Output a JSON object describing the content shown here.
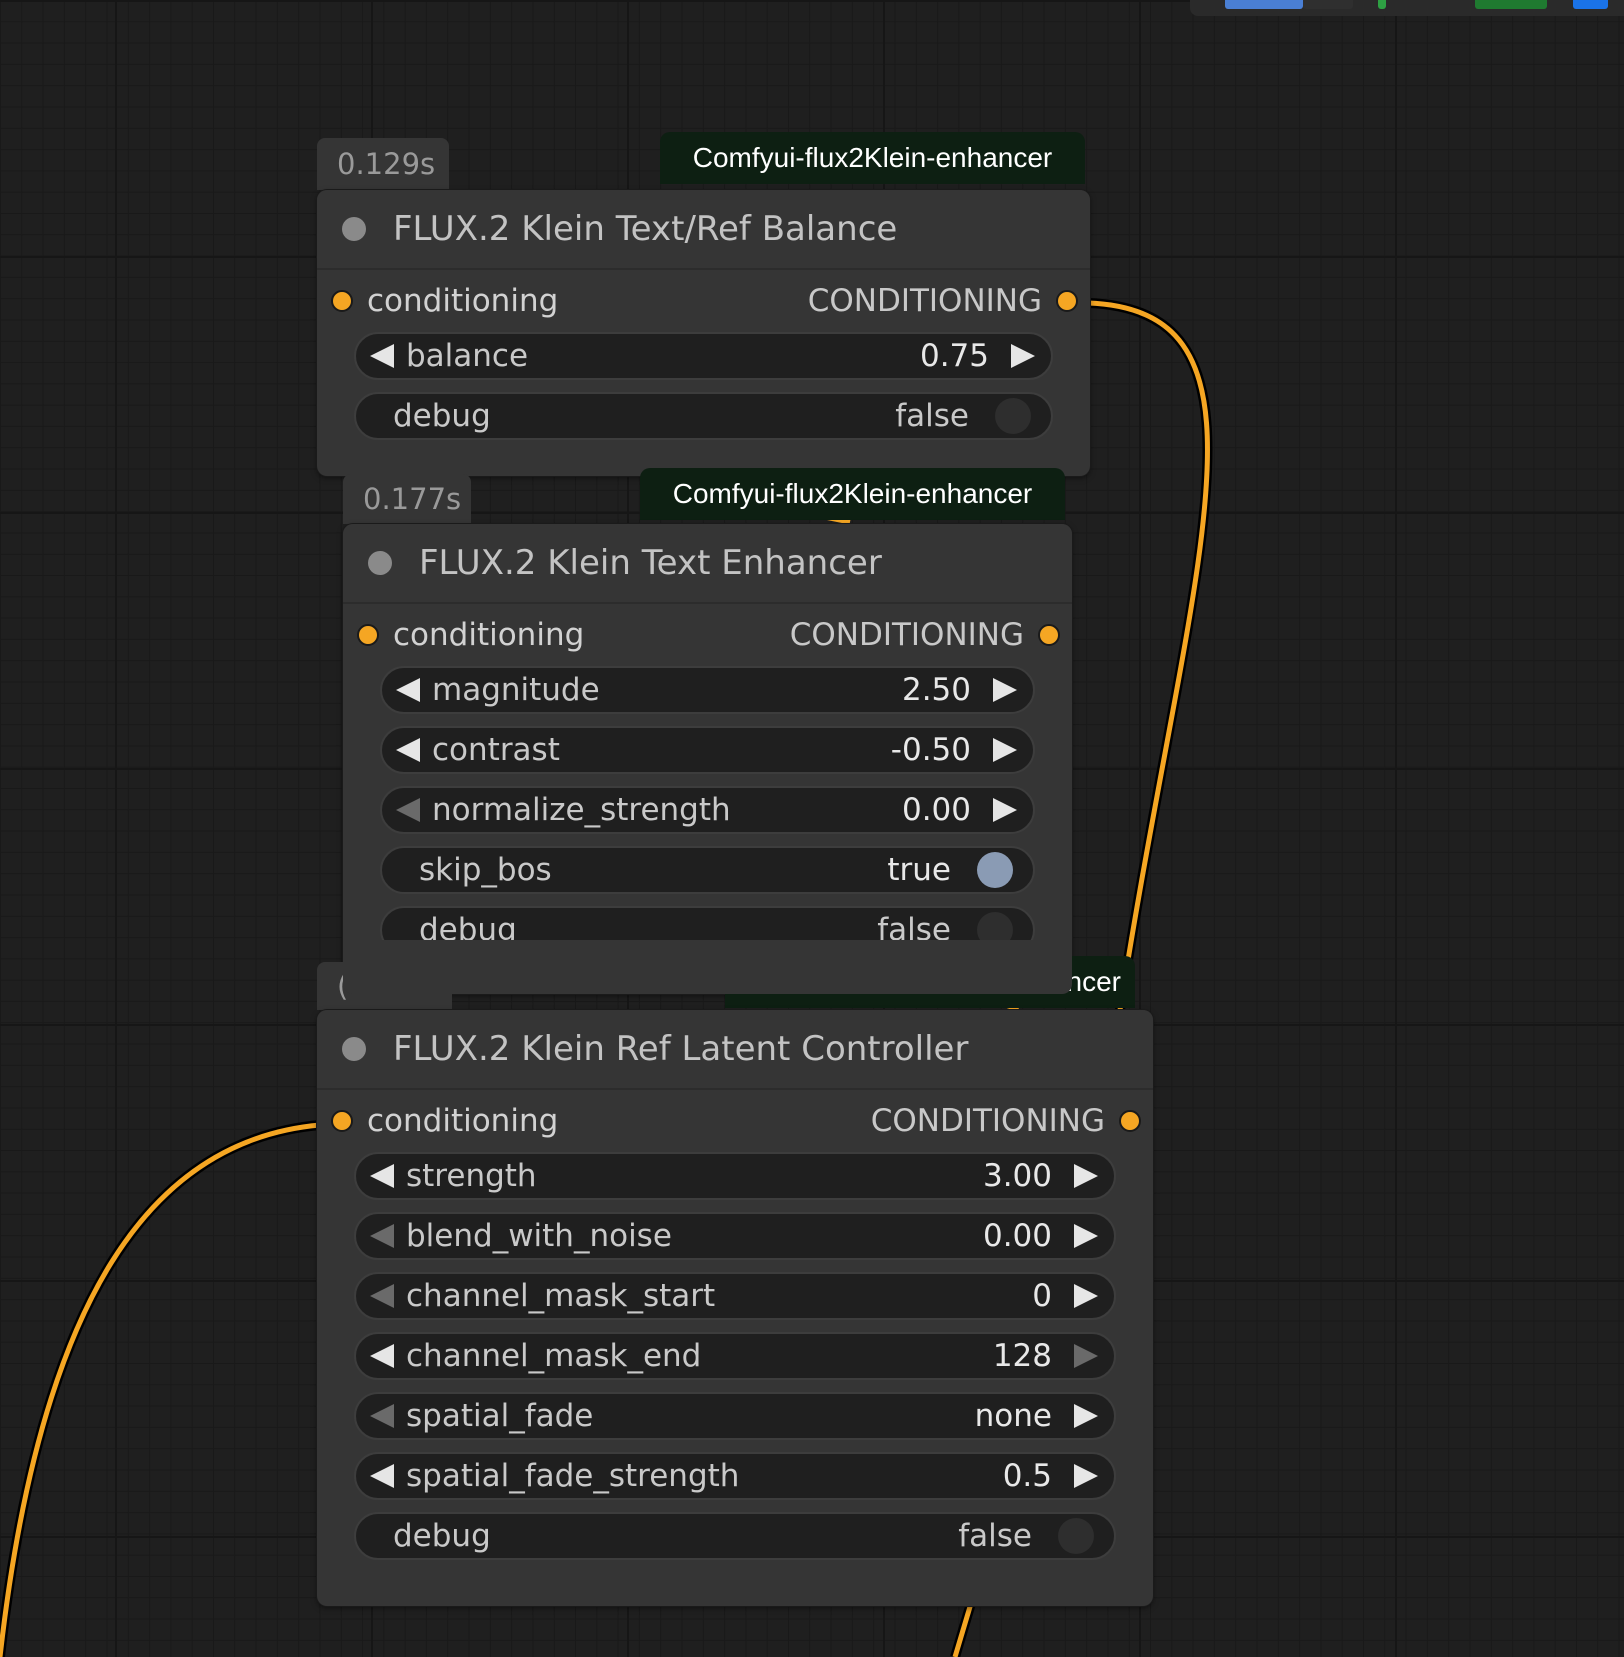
{
  "colors": {
    "wire": "#f5a623",
    "background": "#1f1f1f",
    "node_bg": "#353535",
    "source_badge_bg": "#0d1f12",
    "toggle_on": "#8a9bb4"
  },
  "nodes": [
    {
      "time": "0.129s",
      "source": "Comfyui-flux2Klein-enhancer",
      "title": "FLUX.2 Klein Text/Ref Balance",
      "input": "conditioning",
      "output": "CONDITIONING",
      "widgets": [
        {
          "name": "balance",
          "value": "0.75",
          "kind": "number"
        },
        {
          "name": "debug",
          "value": "false",
          "kind": "toggle"
        }
      ]
    },
    {
      "time": "0.177s",
      "source": "Comfyui-flux2Klein-enhancer",
      "title": "FLUX.2 Klein Text Enhancer",
      "input": "conditioning",
      "output": "CONDITIONING",
      "widgets": [
        {
          "name": "magnitude",
          "value": "2.50",
          "kind": "number"
        },
        {
          "name": "contrast",
          "value": "-0.50",
          "kind": "number"
        },
        {
          "name": "normalize_strength",
          "value": "0.00",
          "kind": "number"
        },
        {
          "name": "skip_bos",
          "value": "true",
          "kind": "toggle"
        },
        {
          "name": "debug",
          "value": "false",
          "kind": "toggle"
        }
      ]
    },
    {
      "time": "(",
      "source": "ncer",
      "title": "FLUX.2 Klein Ref Latent Controller",
      "input": "conditioning",
      "output": "CONDITIONING",
      "widgets": [
        {
          "name": "strength",
          "value": "3.00",
          "kind": "number"
        },
        {
          "name": "blend_with_noise",
          "value": "0.00",
          "kind": "number"
        },
        {
          "name": "channel_mask_start",
          "value": "0",
          "kind": "number"
        },
        {
          "name": "channel_mask_end",
          "value": "128",
          "kind": "number"
        },
        {
          "name": "spatial_fade",
          "value": "none",
          "kind": "combo"
        },
        {
          "name": "spatial_fade_strength",
          "value": "0.5",
          "kind": "number"
        },
        {
          "name": "debug",
          "value": "false",
          "kind": "toggle"
        }
      ]
    }
  ]
}
